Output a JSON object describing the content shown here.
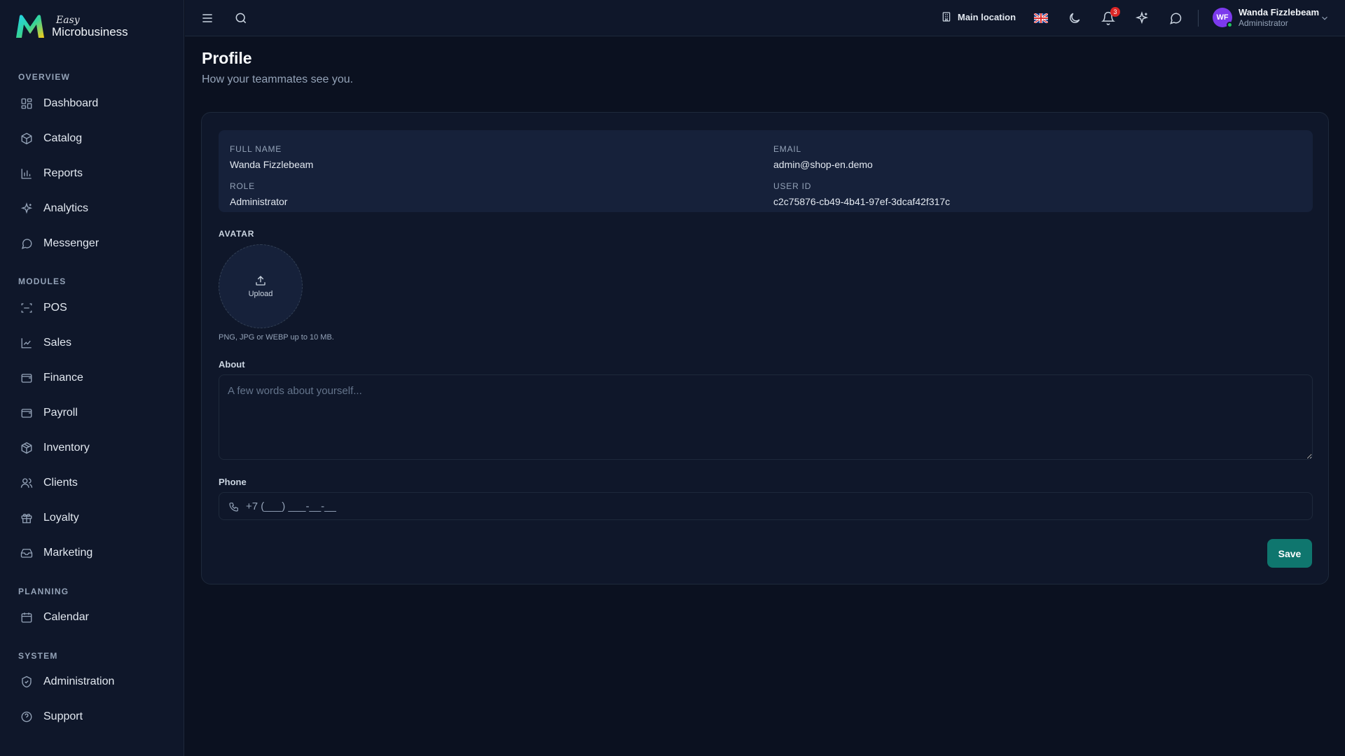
{
  "brand": {
    "easy": "Easy",
    "name": "Microbusiness"
  },
  "sidebar": {
    "sections": [
      {
        "label": "OVERVIEW"
      },
      {
        "label": "MODULES"
      },
      {
        "label": "PLANNING"
      },
      {
        "label": "SYSTEM"
      }
    ],
    "items": [
      {
        "label": "Dashboard",
        "icon": "dashboard-icon"
      },
      {
        "label": "Catalog",
        "icon": "catalog-icon"
      },
      {
        "label": "Reports",
        "icon": "reports-icon"
      },
      {
        "label": "Analytics",
        "icon": "sparkles-icon"
      },
      {
        "label": "Messenger",
        "icon": "chat-icon"
      },
      {
        "label": "POS",
        "icon": "scan-icon"
      },
      {
        "label": "Sales",
        "icon": "trend-icon"
      },
      {
        "label": "Finance",
        "icon": "wallet-icon"
      },
      {
        "label": "Payroll",
        "icon": "wallet-icon"
      },
      {
        "label": "Inventory",
        "icon": "box-icon"
      },
      {
        "label": "Clients",
        "icon": "users-icon"
      },
      {
        "label": "Loyalty",
        "icon": "gift-icon"
      },
      {
        "label": "Marketing",
        "icon": "inbox-icon"
      },
      {
        "label": "Calendar",
        "icon": "calendar-icon"
      },
      {
        "label": "Administration",
        "icon": "shield-icon"
      },
      {
        "label": "Support",
        "icon": "help-icon"
      }
    ]
  },
  "topbar": {
    "location": "Main location",
    "notifications_count": "3",
    "user": {
      "initials": "WF",
      "name": "Wanda Fizzlebeam",
      "role": "Administrator"
    }
  },
  "page": {
    "title": "Profile",
    "subtitle": "How your teammates see you."
  },
  "profile": {
    "full_name_label": "FULL NAME",
    "full_name": "Wanda Fizzlebeam",
    "email_label": "EMAIL",
    "email": "admin@shop-en.demo",
    "role_label": "ROLE",
    "role": "Administrator",
    "user_id_label": "USER ID",
    "user_id": "c2c75876-cb49-4b41-97ef-3dcaf42f317c"
  },
  "avatar": {
    "label": "AVATAR",
    "upload_label": "Upload",
    "hint": "PNG, JPG or WEBP up to 10 MB."
  },
  "form": {
    "about_label": "About",
    "about_placeholder": "A few words about yourself...",
    "phone_label": "Phone",
    "phone_placeholder": "+7 (___) ___-__-__",
    "save_label": "Save"
  },
  "colors": {
    "background": "#0b1120",
    "panel": "#0f172a",
    "accent": "#0f766e",
    "avatar": "#7c3aed",
    "badge": "#dc2626"
  }
}
